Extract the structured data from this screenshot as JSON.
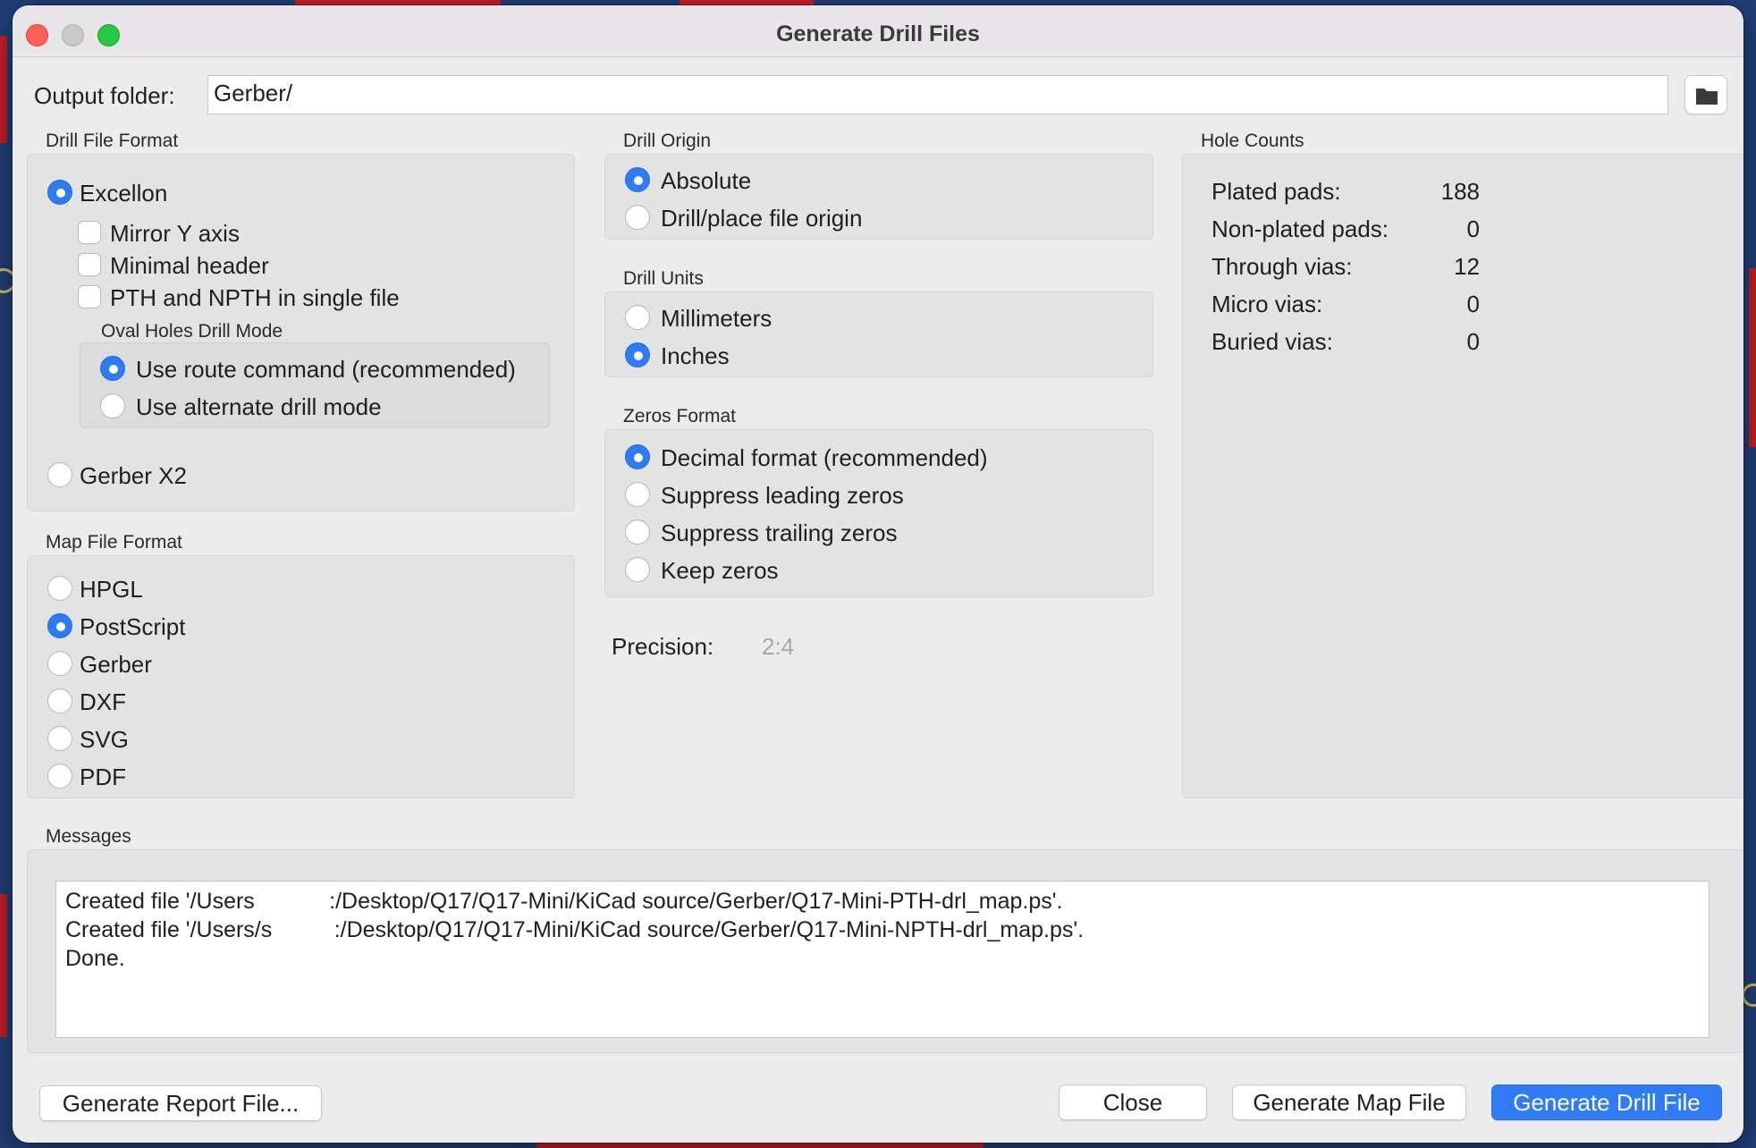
{
  "window": {
    "title": "Generate Drill Files"
  },
  "output": {
    "label": "Output folder:",
    "value": "Gerber/"
  },
  "drill_file_format": {
    "title": "Drill File Format",
    "excellon": "Excellon",
    "mirror_y": "Mirror Y axis",
    "minimal_header": "Minimal header",
    "pth_npth_single": "PTH and NPTH in single file",
    "oval_title": "Oval Holes Drill Mode",
    "oval_route": "Use route command (recommended)",
    "oval_alternate": "Use alternate drill mode",
    "gerber_x2": "Gerber X2",
    "selected": "Excellon",
    "oval_selected": "Use route command (recommended)"
  },
  "map_file_format": {
    "title": "Map File Format",
    "options": [
      "HPGL",
      "PostScript",
      "Gerber",
      "DXF",
      "SVG",
      "PDF"
    ],
    "selected": "PostScript"
  },
  "drill_origin": {
    "title": "Drill Origin",
    "options": [
      "Absolute",
      "Drill/place file origin"
    ],
    "selected": "Absolute"
  },
  "drill_units": {
    "title": "Drill Units",
    "options": [
      "Millimeters",
      "Inches"
    ],
    "selected": "Inches"
  },
  "zeros_format": {
    "title": "Zeros Format",
    "options": [
      "Decimal format (recommended)",
      "Suppress leading zeros",
      "Suppress trailing zeros",
      "Keep zeros"
    ],
    "selected": "Decimal format (recommended)"
  },
  "precision": {
    "label": "Precision:",
    "value": "2:4"
  },
  "hole_counts": {
    "title": "Hole Counts",
    "rows": [
      {
        "label": "Plated pads:",
        "value": "188"
      },
      {
        "label": "Non-plated pads:",
        "value": "0"
      },
      {
        "label": "Through vias:",
        "value": "12"
      },
      {
        "label": "Micro vias:",
        "value": "0"
      },
      {
        "label": "Buried vias:",
        "value": "0"
      }
    ]
  },
  "messages": {
    "title": "Messages",
    "lines": [
      "Created file '/Users            :/Desktop/Q17/Q17-Mini/KiCad source/Gerber/Q17-Mini-PTH-drl_map.ps'.",
      "Created file '/Users/s          :/Desktop/Q17/Q17-Mini/KiCad source/Gerber/Q17-Mini-NPTH-drl_map.ps'.",
      "Done."
    ]
  },
  "buttons": {
    "report": "Generate Report File...",
    "close": "Close",
    "map": "Generate Map File",
    "drill": "Generate Drill File"
  },
  "colors": {
    "accent": "#2f7cf6",
    "window_bg": "#ececec"
  },
  "icons": {
    "folder": "folder-icon"
  }
}
